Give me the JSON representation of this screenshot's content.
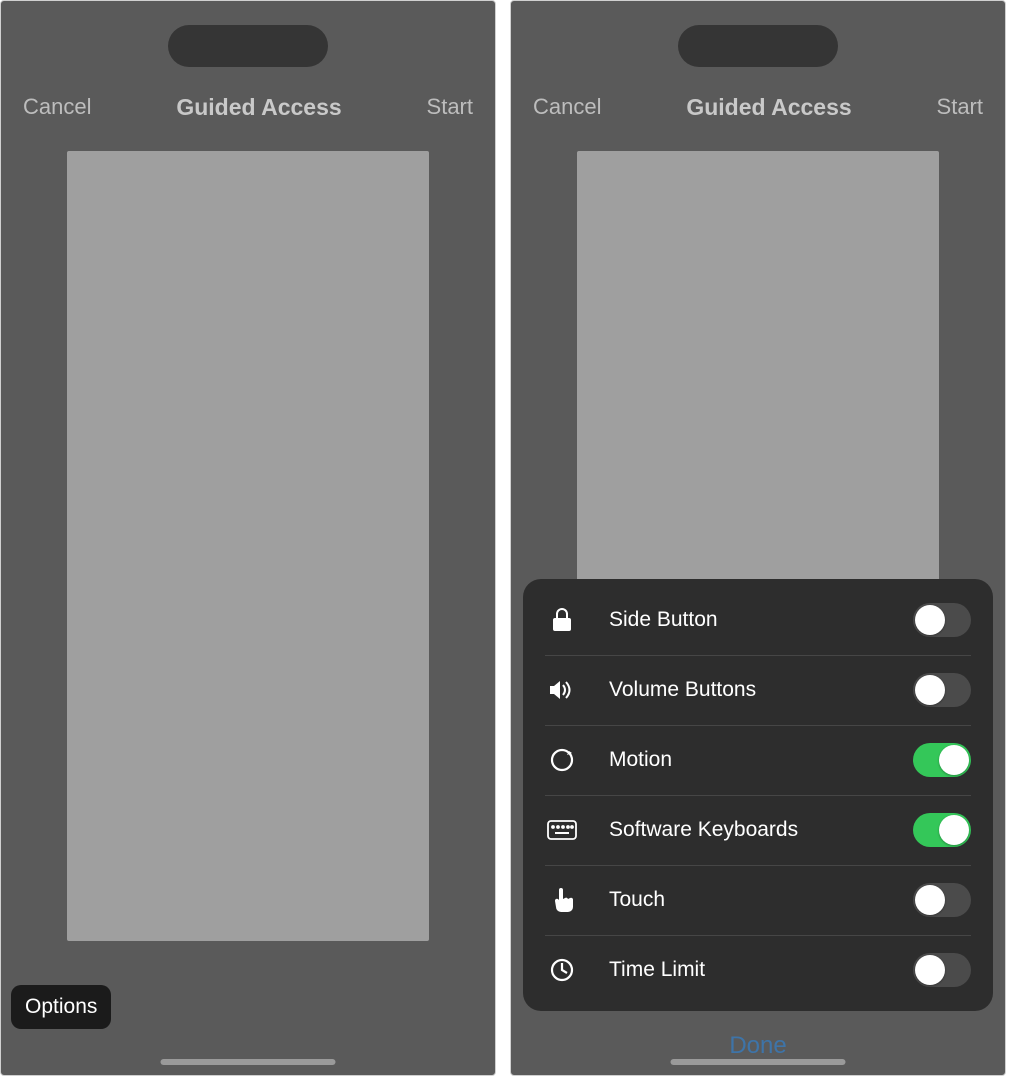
{
  "left": {
    "nav": {
      "cancel": "Cancel",
      "title": "Guided Access",
      "start": "Start"
    },
    "options_button": "Options"
  },
  "right": {
    "nav": {
      "cancel": "Cancel",
      "title": "Guided Access",
      "start": "Start"
    },
    "panel": {
      "items": [
        {
          "icon": "lock-icon",
          "label": "Side Button",
          "on": false
        },
        {
          "icon": "speaker-icon",
          "label": "Volume Buttons",
          "on": false
        },
        {
          "icon": "motion-icon",
          "label": "Motion",
          "on": true
        },
        {
          "icon": "keyboard-icon",
          "label": "Software Keyboards",
          "on": true
        },
        {
          "icon": "touch-icon",
          "label": "Touch",
          "on": false
        },
        {
          "icon": "timer-icon",
          "label": "Time Limit",
          "on": false
        }
      ]
    },
    "done": "Done"
  },
  "colors": {
    "toggle_on": "#34c759"
  }
}
